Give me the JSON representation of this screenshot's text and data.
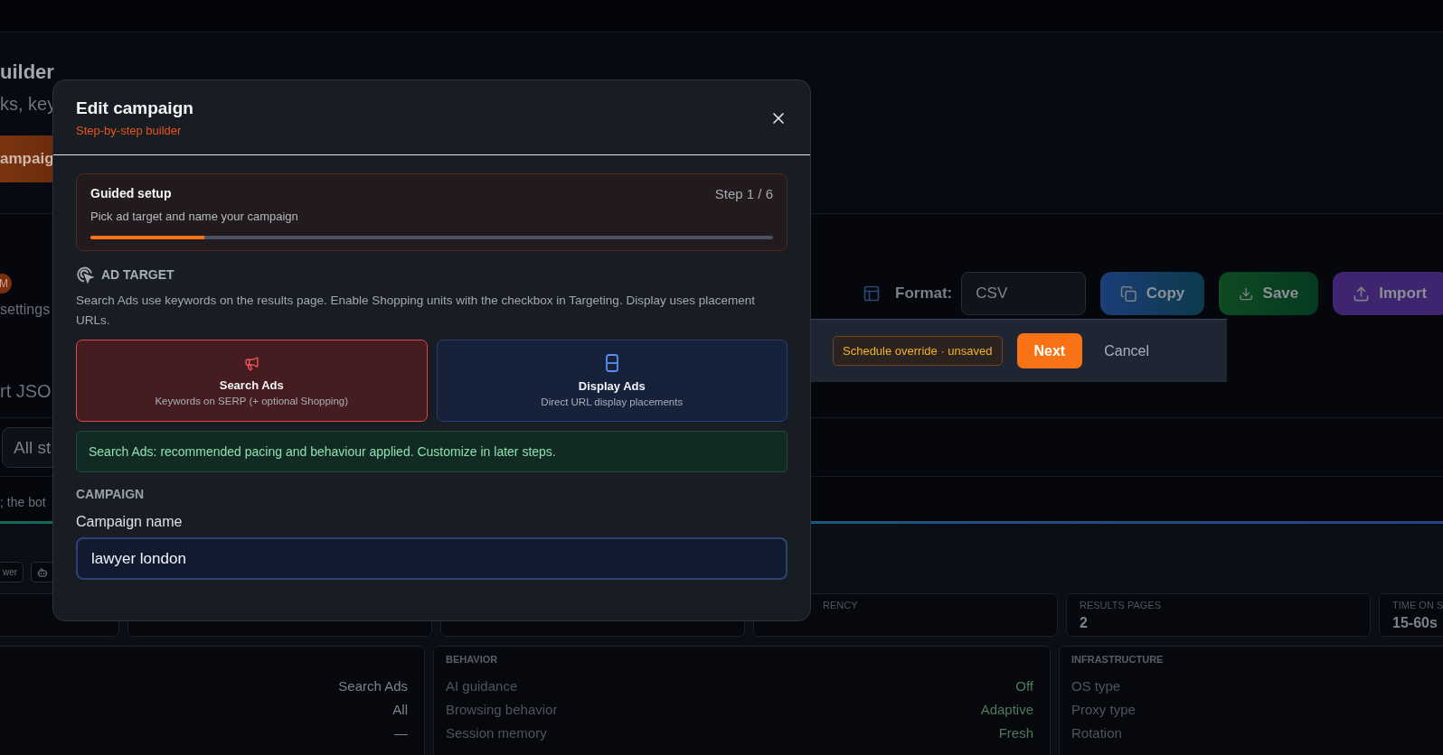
{
  "background": {
    "heading": "uilder",
    "subheading": "ks, key",
    "primary_button": "ampaig",
    "badge": "M",
    "settings_label": "settings",
    "section_label": "rt JSO",
    "format": {
      "label": "Format:",
      "value": "CSV"
    },
    "buttons": [
      {
        "kind": "copy",
        "label": "Copy"
      },
      {
        "kind": "save",
        "label": "Save"
      },
      {
        "kind": "import",
        "label": "Import"
      }
    ],
    "action_bar": {
      "status": "Schedule override · unsaved",
      "primary": "Next",
      "secondary": "Cancel"
    },
    "filter_field": {
      "value": "All st"
    },
    "note": "; the bot",
    "chips": [
      {
        "kind": "text",
        "label": "wer"
      },
      {
        "kind": "robot"
      }
    ],
    "stats": [
      {
        "kind": "clipped",
        "label": "RENCY"
      },
      {
        "kind": "full",
        "label": "RESULTS PAGES",
        "value": "2"
      },
      {
        "kind": "full",
        "label": "TIME ON S",
        "value": "15-60s"
      }
    ],
    "panels": [
      {
        "kind": "values",
        "rows": [
          {
            "value": "Search Ads"
          },
          {
            "value": "All"
          },
          {
            "value": "—"
          }
        ]
      },
      {
        "kind": "settings",
        "title": "BEHAVIOR",
        "rows": [
          {
            "label": "AI guidance",
            "value": "Off"
          },
          {
            "label": "Browsing behavior",
            "value": "Adaptive"
          },
          {
            "label": "Session memory",
            "value": "Fresh"
          }
        ]
      },
      {
        "kind": "labels",
        "title": "INFRASTRUCTURE",
        "rows": [
          {
            "label": "OS type"
          },
          {
            "label": "Proxy type"
          },
          {
            "label": "Rotation"
          }
        ]
      }
    ]
  },
  "modal": {
    "title": "Edit campaign",
    "subtitle": "Step-by-step builder",
    "guide": {
      "title": "Guided setup",
      "step": "Step 1 / 6",
      "description": "Pick ad target and name your campaign",
      "level": 0.167
    },
    "ad_target": {
      "heading": "AD TARGET",
      "description": "Search Ads use keywords on the results page. Enable Shopping units with the checkbox in Targeting. Display uses placement URLs.",
      "options": [
        {
          "kind": "search",
          "title": "Search Ads",
          "description": "Keywords on SERP (+ optional Shopping)",
          "selected": true
        },
        {
          "kind": "display",
          "title": "Display Ads",
          "description": "Direct URL display placements",
          "selected": false
        }
      ],
      "notice": "Search Ads: recommended pacing and behaviour applied. Customize in later steps."
    },
    "campaign": {
      "heading": "CAMPAIGN",
      "label": "Campaign name",
      "value": "lawyer london"
    }
  }
}
